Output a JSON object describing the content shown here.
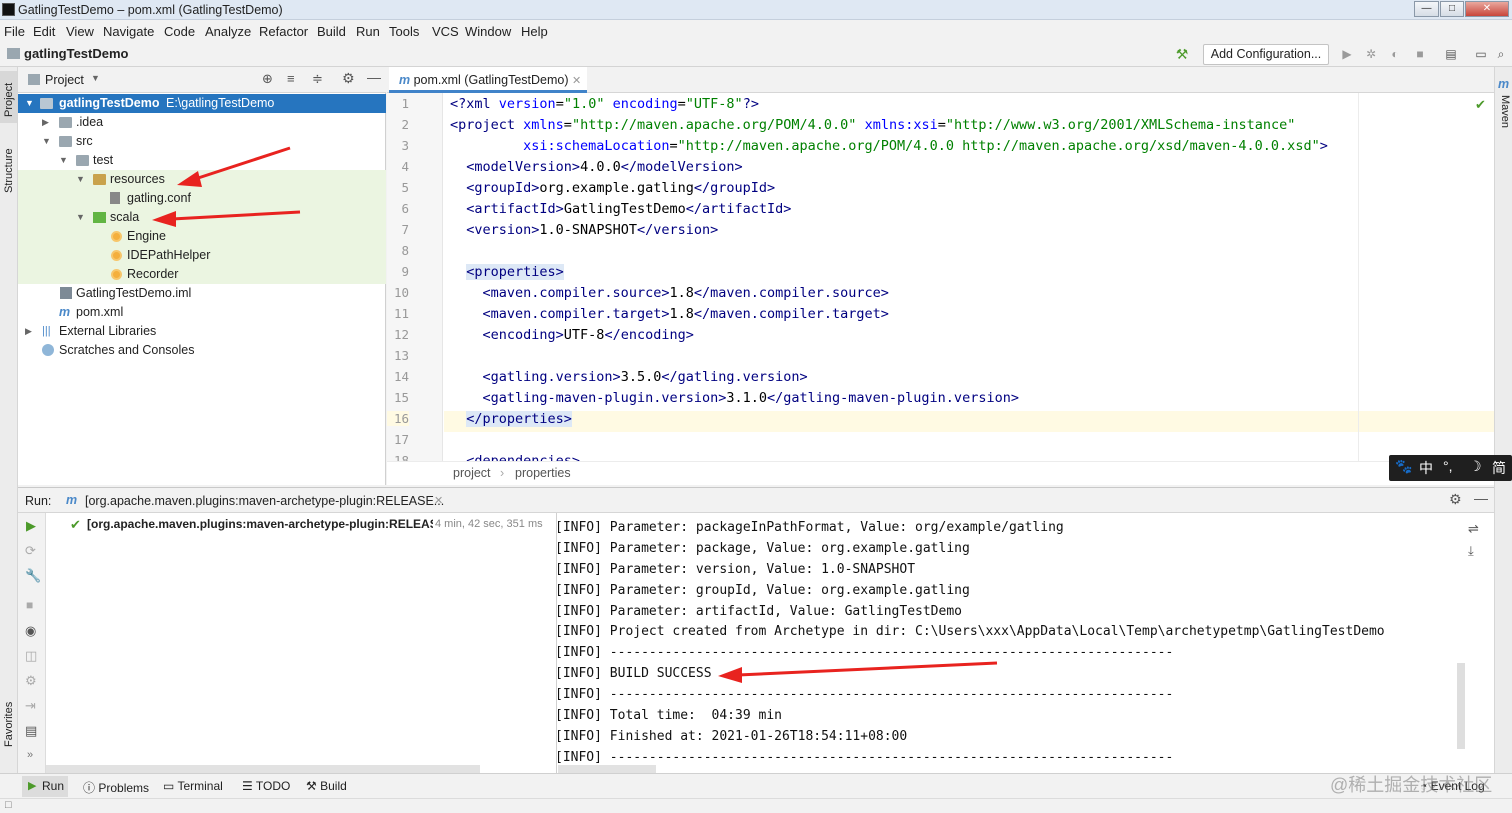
{
  "window": {
    "title": "GatlingTestDemo – pom.xml (GatlingTestDemo)"
  },
  "menu": [
    "File",
    "Edit",
    "View",
    "Navigate",
    "Code",
    "Analyze",
    "Refactor",
    "Build",
    "Run",
    "Tools",
    "VCS",
    "Window",
    "Help"
  ],
  "navbar": {
    "project": "gatlingTestDemo",
    "add_config": "Add Configuration..."
  },
  "stripes": {
    "left_top": "Project",
    "left_structure": "Structure",
    "left_favorites": "Favorites",
    "right_maven": "Maven"
  },
  "project_panel": {
    "title": "Project",
    "tree": [
      {
        "label": "gatlingTestDemo",
        "path": "E:\\gatlingTestDemo"
      },
      {
        "label": ".idea"
      },
      {
        "label": "src"
      },
      {
        "label": "test"
      },
      {
        "label": "resources"
      },
      {
        "label": "gatling.conf"
      },
      {
        "label": "scala"
      },
      {
        "label": "Engine"
      },
      {
        "label": "IDEPathHelper"
      },
      {
        "label": "Recorder"
      },
      {
        "label": "GatlingTestDemo.iml"
      },
      {
        "label": "pom.xml"
      },
      {
        "label": "External Libraries"
      },
      {
        "label": "Scratches and Consoles"
      }
    ]
  },
  "editor": {
    "tab": "pom.xml (GatlingTestDemo)",
    "line_numbers": [
      "1",
      "2",
      "3",
      "4",
      "5",
      "6",
      "7",
      "8",
      "9",
      "10",
      "11",
      "12",
      "13",
      "14",
      "15",
      "16",
      "17",
      "18"
    ],
    "breadcrumbs": [
      "project",
      "properties"
    ]
  },
  "run": {
    "label": "Run:",
    "tab": "[org.apache.maven.plugins:maven-archetype-plugin:RELEASE...",
    "tree_item": "[org.apache.maven.plugins:maven-archetype-plugin:RELEAS",
    "duration": "4 min, 42 sec, 351 ms",
    "console": [
      "[INFO] Parameter: package, Value: org.example.gatling",
      "[INFO] Parameter: packageInPathFormat, Value: org/example/gatling",
      "[INFO] Parameter: package, Value: org.example.gatling",
      "[INFO] Parameter: version, Value: 1.0-SNAPSHOT",
      "[INFO] Parameter: groupId, Value: org.example.gatling",
      "[INFO] Parameter: artifactId, Value: GatlingTestDemo",
      "[INFO] Project created from Archetype in dir: C:\\Users\\xxx\\AppData\\Local\\Temp\\archetypetmp\\GatlingTestDemo",
      "[INFO] ------------------------------------------------------------------------",
      "[INFO] BUILD SUCCESS",
      "[INFO] ------------------------------------------------------------------------",
      "[INFO] Total time:  04:39 min",
      "[INFO] Finished at: 2021-01-26T18:54:11+08:00",
      "[INFO] ------------------------------------------------------------------------"
    ]
  },
  "bottom_tabs": [
    "Run",
    "Problems",
    "Terminal",
    "TODO",
    "Build"
  ],
  "event_log": "Event Log",
  "watermark": "@稀土掘金技术社区",
  "ime": [
    "中",
    "°,",
    "☽",
    "简"
  ],
  "colors": {
    "accent": "#4083c9",
    "tag": "#000080",
    "attr": "#0000ff",
    "value": "#008000",
    "arrow": "#e8231f",
    "selection": "#dde8f6"
  }
}
